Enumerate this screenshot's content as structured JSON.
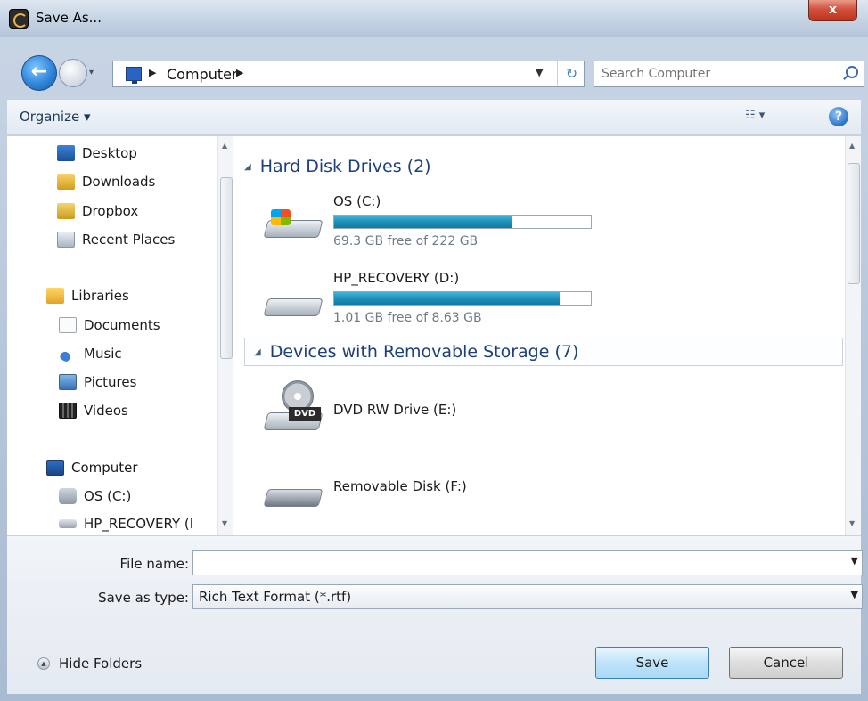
{
  "window": {
    "title": "Save As...",
    "close_label": "x"
  },
  "nav": {
    "breadcrumb": "Computer",
    "search_placeholder": "Search Computer"
  },
  "toolbar": {
    "organize_label": "Organize ▾",
    "views_label": "☷ ▾",
    "help_label": "?"
  },
  "sidebar": {
    "items": [
      {
        "label": "Desktop",
        "icon": "desktop-icon"
      },
      {
        "label": "Downloads",
        "icon": "downloads-icon"
      },
      {
        "label": "Dropbox",
        "icon": "dropbox-icon"
      },
      {
        "label": "Recent Places",
        "icon": "recent-places-icon"
      },
      {
        "label": "Libraries",
        "icon": "libraries-icon"
      },
      {
        "label": "Documents",
        "icon": "documents-icon"
      },
      {
        "label": "Music",
        "icon": "music-icon"
      },
      {
        "label": "Pictures",
        "icon": "pictures-icon"
      },
      {
        "label": "Videos",
        "icon": "videos-icon"
      },
      {
        "label": "Computer",
        "icon": "computer-icon"
      },
      {
        "label": "OS (C:)",
        "icon": "drive-icon"
      },
      {
        "label": "HP_RECOVERY (I",
        "icon": "drive-icon"
      }
    ]
  },
  "content": {
    "groups": [
      {
        "header": "Hard Disk Drives (2)"
      },
      {
        "header": "Devices with Removable Storage (7)"
      }
    ],
    "drives": [
      {
        "name": "OS (C:)",
        "free": "69.3 GB free of 222 GB",
        "used_fraction": 0.69
      },
      {
        "name": "HP_RECOVERY (D:)",
        "free": "1.01 GB free of 8.63 GB",
        "used_fraction": 0.88
      }
    ],
    "devices": [
      {
        "name": "DVD RW Drive (E:)",
        "badge": "DVD"
      },
      {
        "name": "Removable Disk (F:)"
      }
    ]
  },
  "form": {
    "filename_label": "File name:",
    "filename_value": "",
    "type_label": "Save as type:",
    "type_value": "Rich Text Format (*.rtf)",
    "hide_folders_label": "Hide Folders",
    "save_label": "Save",
    "cancel_label": "Cancel"
  }
}
